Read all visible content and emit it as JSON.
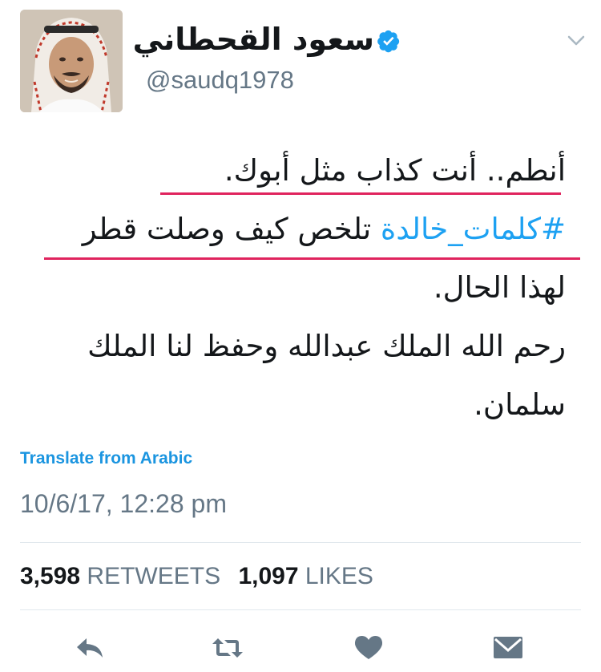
{
  "user": {
    "display_name": "سعود القحطاني",
    "handle": "@saudq1978",
    "avatar_icon": "profile-photo",
    "verified_icon": "verified-badge-icon"
  },
  "tweet": {
    "line1": "أنطم.. أنت كذاب مثل أبوك.",
    "hashtag": "#كلمات_خالدة",
    "line2_rest": " تلخص كيف وصلت قطر",
    "line3": "لهذا الحال.",
    "line4": "رحم الله الملك عبدالله وحفظ لنا الملك",
    "line5": "سلمان."
  },
  "translate_label": "Translate from Arabic",
  "timestamp": "10/6/17, 12:28 pm",
  "stats": {
    "retweets_count": "3,598",
    "retweets_label": "RETWEETS",
    "likes_count": "1,097",
    "likes_label": "LIKES"
  },
  "colors": {
    "accent": "#1da1f2",
    "underline": "#e0245e",
    "muted": "#657786",
    "icon": "#657786"
  },
  "actions": [
    "reply-icon",
    "retweet-icon",
    "like-icon",
    "message-icon"
  ]
}
